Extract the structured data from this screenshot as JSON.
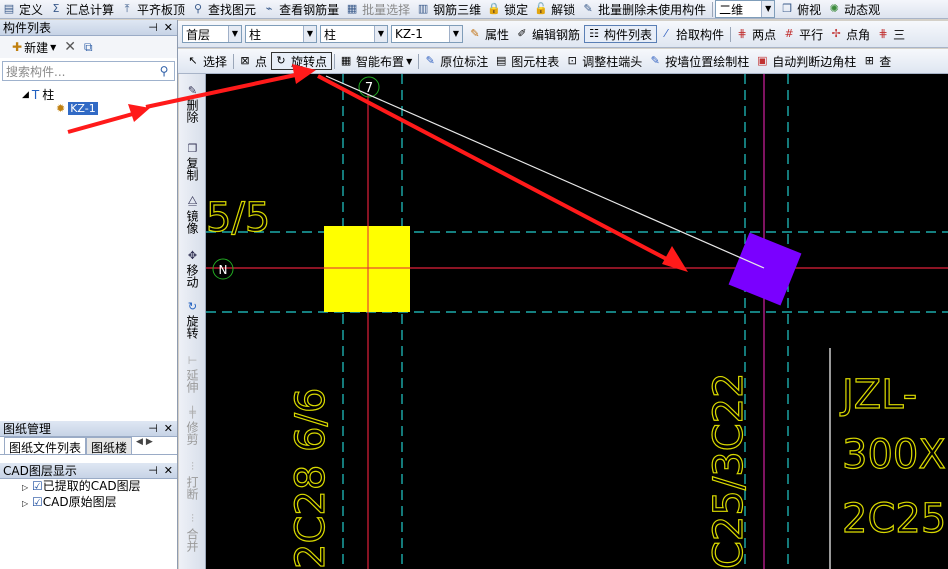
{
  "toolbar1": [
    {
      "label": "定义",
      "icon": "define-icon"
    },
    {
      "label": "汇总计算",
      "icon": "sigma-icon"
    },
    {
      "label": "平齐板顶",
      "icon": "align-icon"
    },
    {
      "label": "查找图元",
      "icon": "find-icon"
    },
    {
      "label": "查看钢筋量",
      "icon": "rebar-view-icon"
    },
    {
      "label": "批量选择",
      "icon": "batch-select-icon",
      "disabled": true
    },
    {
      "label": "钢筋三维",
      "icon": "rebar-3d-icon"
    },
    {
      "label": "锁定",
      "icon": "lock-icon"
    },
    {
      "label": "解锁",
      "icon": "unlock-icon"
    },
    {
      "label": "批量删除未使用构件",
      "icon": "batch-delete-icon"
    }
  ],
  "view": {
    "mode": "二维",
    "top_view": "俯视",
    "dynamic": "动态观"
  },
  "toolbar2": {
    "floor": "首层",
    "type": "柱",
    "subtype": "柱",
    "component": "KZ-1",
    "buttons": [
      "属性",
      "编辑钢筋",
      "构件列表",
      "拾取构件"
    ],
    "draw_buttons": [
      "两点",
      "平行",
      "点角",
      "三"
    ]
  },
  "toolbar3": {
    "buttons": [
      "选择",
      "点",
      "旋转点",
      "智能布置",
      "原位标注",
      "图元柱表",
      "调整柱端头",
      "按墙位置绘制柱",
      "自动判断边角柱",
      "查"
    ]
  },
  "left": {
    "component_list_title": "构件列表",
    "new_label": "新建",
    "search_placeholder": "搜索构件...",
    "tree_root": "柱",
    "tree_child": "KZ-1",
    "drawing_mgmt_title": "图纸管理",
    "tab_files": "图纸文件列表",
    "tab_floors": "图纸楼",
    "cad_layer_title": "CAD图层显示",
    "cad_layers": [
      "已提取的CAD图层",
      "CAD原始图层"
    ]
  },
  "vbar": [
    {
      "label": "删除",
      "icon": "delete-icon"
    },
    {
      "label": "复制",
      "icon": "copy-icon"
    },
    {
      "label": "镜像",
      "icon": "mirror-icon"
    },
    {
      "label": "移动",
      "icon": "move-icon"
    },
    {
      "label": "旋转",
      "icon": "rotate-icon"
    },
    {
      "label": "延伸",
      "icon": "extend-icon",
      "disabled": true
    },
    {
      "label": "修剪",
      "icon": "trim-icon",
      "disabled": true
    },
    {
      "label": "打断",
      "icon": "break-icon",
      "disabled": true
    },
    {
      "label": "合并",
      "icon": "merge-icon",
      "disabled": true
    }
  ],
  "canvas": {
    "axis_top": "7",
    "axis_left": "N",
    "text_fragment": "5/5",
    "rebar_left": "2C28 6/6",
    "rebar_mid": "C25/3C22",
    "beam_label": "JZL-",
    "beam_size": "300X",
    "beam_rebar": "2C25",
    "colors": {
      "square_column": "#ffff00",
      "rotated_column": "#7a00ff",
      "annotation_arrow": "#ff1a1a"
    }
  }
}
